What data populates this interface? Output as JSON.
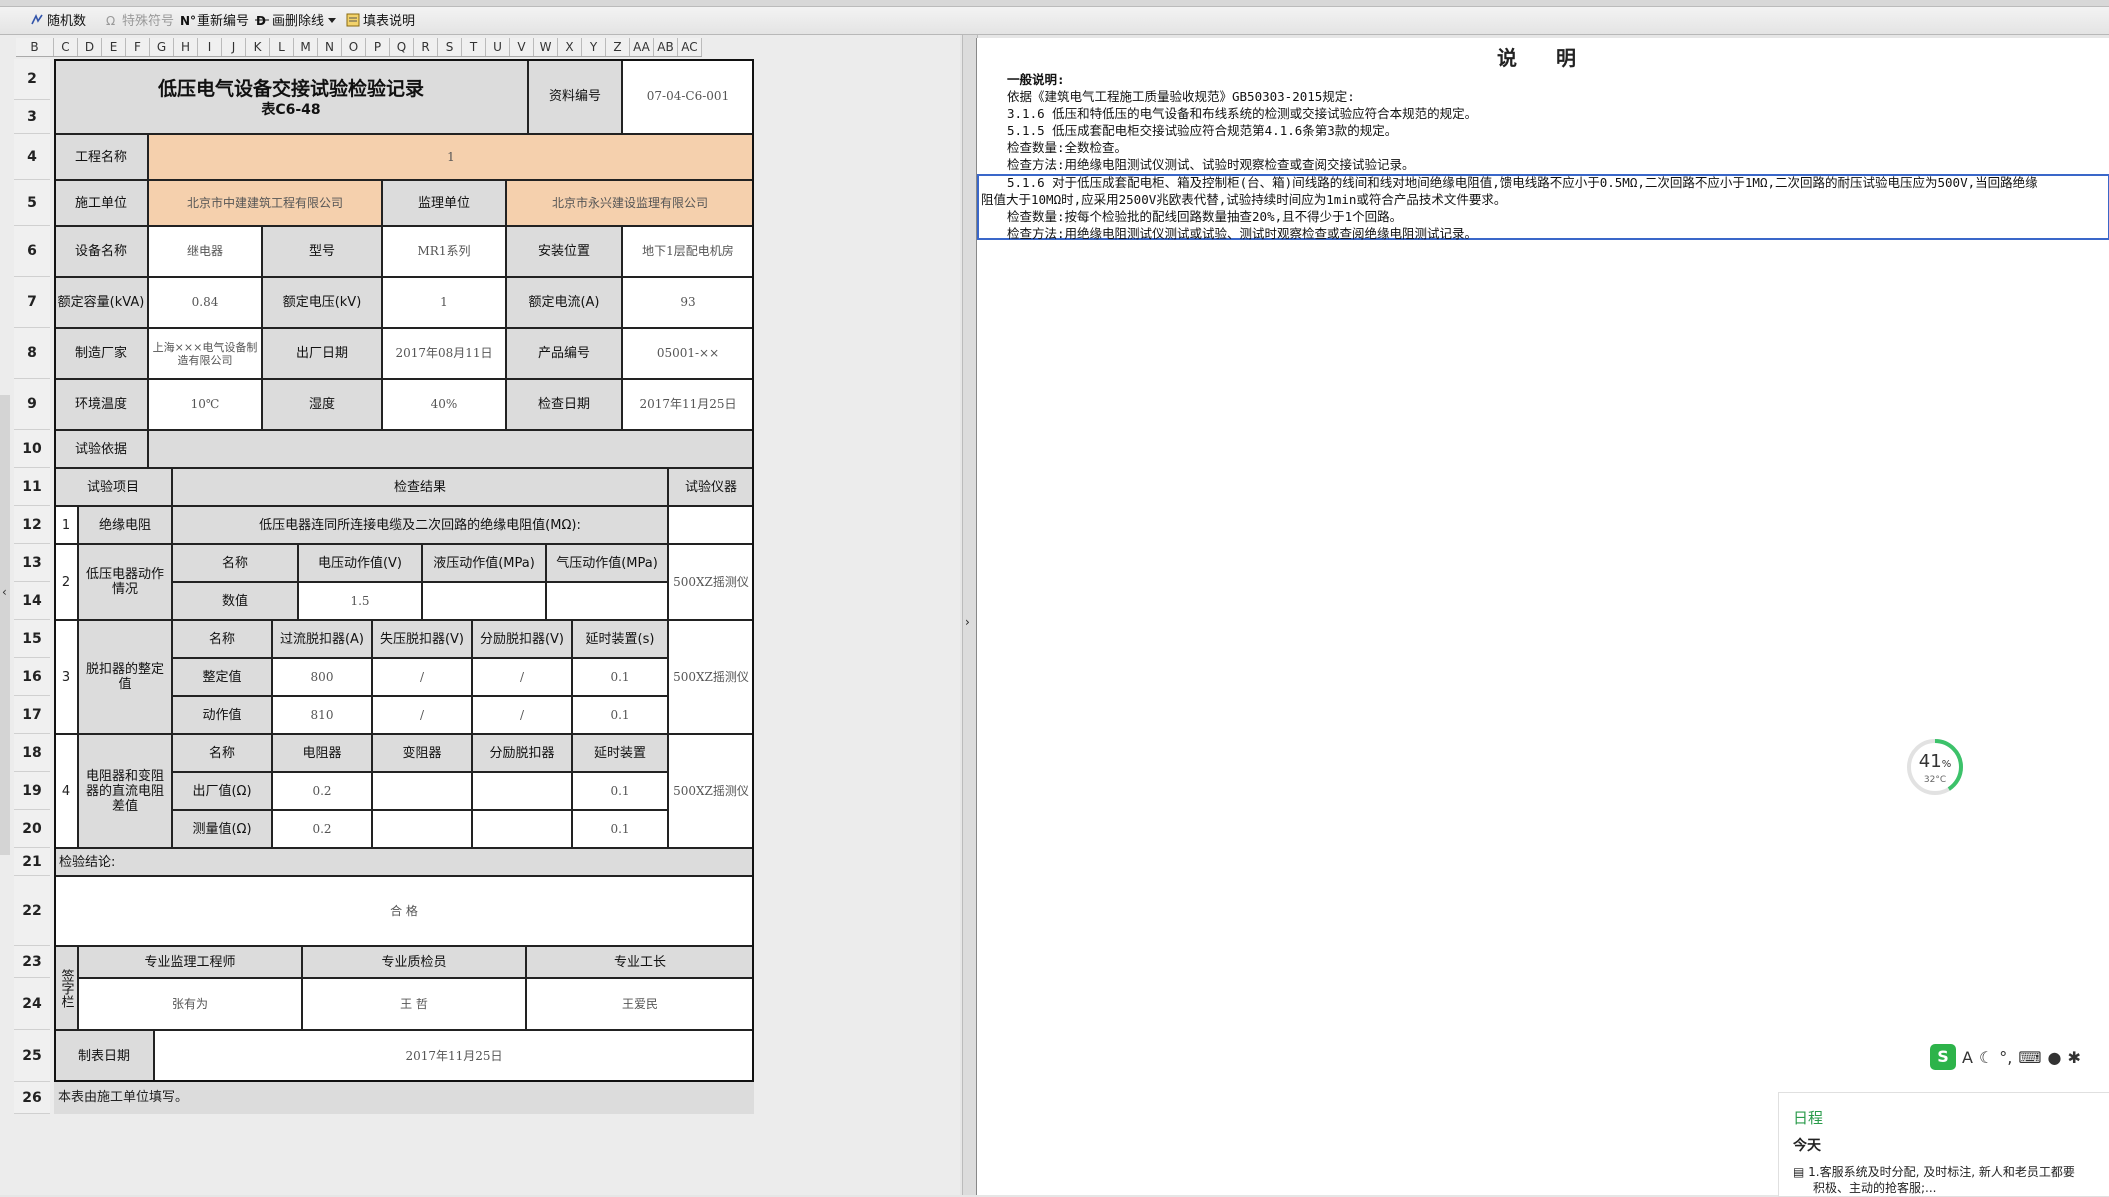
{
  "toolbar": {
    "items": [
      "随机数",
      "特殊符号",
      "重新编号",
      "画删除线",
      "填表说明"
    ]
  },
  "columns": [
    "B",
    "C",
    "D",
    "E",
    "F",
    "G",
    "H",
    "I",
    "J",
    "K",
    "L",
    "M",
    "N",
    "O",
    "P",
    "Q",
    "R",
    "S",
    "T",
    "U",
    "V",
    "W",
    "X",
    "Y",
    "Z",
    "AA",
    "AB",
    "AC"
  ],
  "rows": [
    "2",
    "3",
    "4",
    "5",
    "6",
    "7",
    "8",
    "9",
    "10",
    "11",
    "12",
    "13",
    "14",
    "15",
    "16",
    "17",
    "18",
    "19",
    "20",
    "21",
    "22",
    "23",
    "24",
    "25",
    "26"
  ],
  "form": {
    "title": "低压电气设备交接试验检验记录",
    "subtitle": "表C6-48",
    "doc_no_label": "资料编号",
    "doc_no": "07-04-C6-001",
    "project_label": "工程名称",
    "project": "1",
    "contractor_label": "施工单位",
    "contractor": "北京市中建建筑工程有限公司",
    "supervisor_label": "监理单位",
    "supervisor": "北京市永兴建设监理有限公司",
    "device_label": "设备名称",
    "device": "继电器",
    "model_label": "型号",
    "model": "MR1系列",
    "location_label": "安装位置",
    "location": "地下1层配电机房",
    "capacity_label": "额定容量(kVA)",
    "capacity": "0.84",
    "voltage_label": "额定电压(kV)",
    "voltage": "1",
    "current_label": "额定电流(A)",
    "current": "93",
    "maker_label": "制造厂家",
    "maker": "上海×××电气设备制造有限公司",
    "date_label": "出厂日期",
    "date": "2017年08月11日",
    "serial_label": "产品编号",
    "serial": "05001-××",
    "temp_label": "环境温度",
    "temp": "10℃",
    "humidity_label": "湿度",
    "humidity": "40%",
    "check_date_label": "检查日期",
    "check_date": "2017年11月25日",
    "basis_label": "试验依据",
    "item_label": "试验项目",
    "result_label": "检查结果",
    "instrument_label": "试验仪器",
    "r12_no": "1",
    "r12_name": "绝缘电阻",
    "r12_text": "低压电器连同所连接电缆及二次回路的绝缘电阻值(MΩ):",
    "s2_no": "2",
    "s2_name": "低压电器动作情况",
    "s2_h": [
      "名称",
      "电压动作值(V)",
      "液压动作值(MPa)",
      "气压动作值(MPa)"
    ],
    "s2_v": [
      "数值",
      "1.5",
      "",
      ""
    ],
    "s2_inst": "500XZ摇测仪",
    "s3_no": "3",
    "s3_name": "脱扣器的整定值",
    "s3_h": [
      "名称",
      "过流脱扣器(A)",
      "失压脱扣器(V)",
      "分励脱扣器(V)",
      "延时装置(s)"
    ],
    "s3_r1": [
      "整定值",
      "800",
      "/",
      "/",
      "0.1"
    ],
    "s3_r2": [
      "动作值",
      "810",
      "/",
      "/",
      "0.1"
    ],
    "s3_inst": "500XZ摇测仪",
    "s4_no": "4",
    "s4_name": "电阻器和变阻器的直流电阻差值",
    "s4_h": [
      "名称",
      "电阻器",
      "变阻器",
      "分励脱扣器",
      "延时装置"
    ],
    "s4_r1": [
      "出厂值(Ω)",
      "0.2",
      "",
      "",
      "0.1"
    ],
    "s4_r2": [
      "测量值(Ω)",
      "0.2",
      "",
      "",
      "0.1"
    ],
    "s4_inst": "500XZ摇测仪",
    "conclusion_label": "检验结论:",
    "conclusion": "合 格",
    "sign_label": "签字栏",
    "sign_h": [
      "专业监理工程师",
      "专业质检员",
      "专业工长"
    ],
    "sign_v": [
      "张有为",
      "王 哲",
      "王爱民"
    ],
    "made_date_label": "制表日期",
    "made_date": "2017年11月25日",
    "footnote": "本表由施工单位填写。"
  },
  "explain": {
    "title": "说 明",
    "lines": [
      "一般说明:",
      "依据《建筑电气工程施工质量验收规范》GB50303-2015规定:",
      "3.1.6  低压和特低压的电气设备和布线系统的检测或交接试验应符合本规范的规定。",
      "5.1.5  低压成套配电柜交接试验应符合规范第4.1.6条第3款的规定。",
      "检查数量:全数检查。",
      "检查方法:用绝缘电阻测试仪测试、试验时观察检查或查阅交接试验记录。",
      "5.1.6  对于低压成套配电柜、箱及控制柜(台、箱)间线路的线间和线对地间绝缘电阻值,馈电线路不应小于0.5MΩ,二次回路不应小于1MΩ,二次回路的耐压试验电压应为500V,当回路绝缘",
      "阻值大于10MΩ时,应采用2500V兆欧表代替,试验持续时间应为1min或符合产品技术文件要求。",
      "检查数量:按每个检验批的配线回路数量抽查20%,且不得少于1个回路。",
      "检查方法:用绝缘电阻测试仪测试或试验、测试时观察检查或查阅绝缘电阻测试记录。"
    ]
  },
  "gauge": {
    "percent": "41",
    "unit": "%",
    "temp": "32°C",
    "value": 0.41,
    "color": "#3cc26a"
  },
  "schedule": {
    "title": "日程",
    "today": "今天",
    "item": "1.客服系统及时分配, 及时标注, 新人和老员工都要",
    "item2": "积极、主动的抢客服;..."
  }
}
